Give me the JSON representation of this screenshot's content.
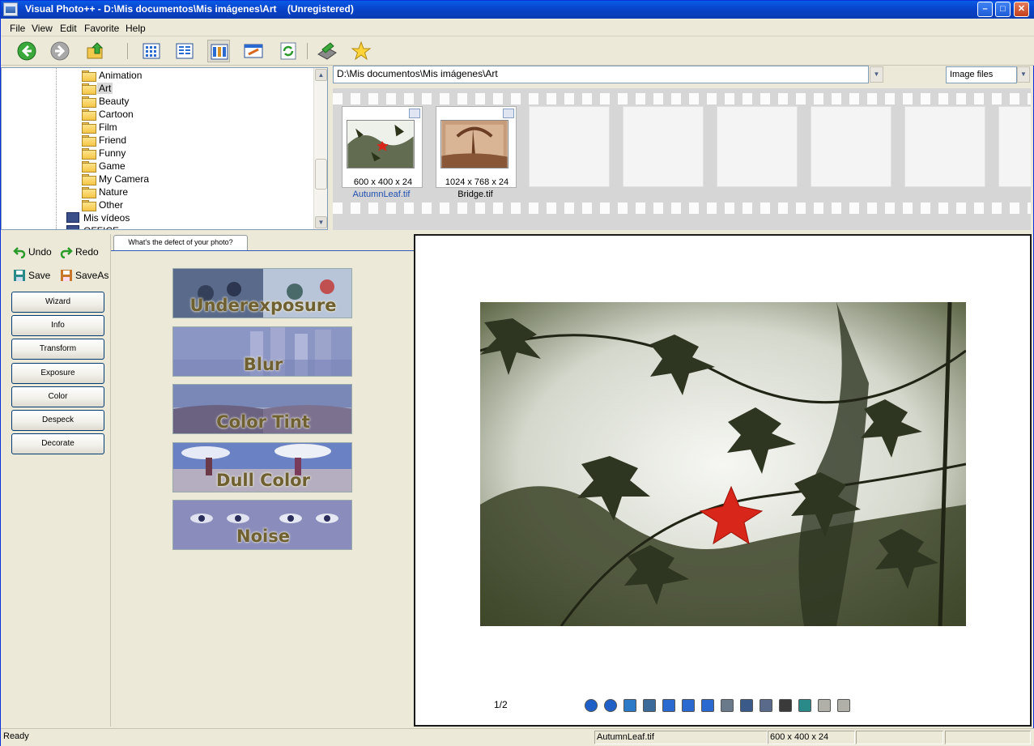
{
  "window": {
    "title": "Visual Photo++ - D:\\Mis documentos\\Mis imágenes\\Art    (Unregistered)",
    "controls": {
      "minimize": "–",
      "maximize": "□",
      "close": "✕"
    }
  },
  "menu": [
    "File",
    "View",
    "Edit",
    "Favorite",
    "Help"
  ],
  "toolbar": {
    "icons": [
      "back-arrow-icon",
      "forward-arrow-icon",
      "up-folder-icon",
      "thumbnail-view-icon",
      "list-view-icon",
      "filmstrip-view-icon",
      "detail-view-icon",
      "refresh-icon",
      "scanner-icon",
      "favorite-star-icon"
    ]
  },
  "tree": {
    "items": [
      {
        "label": "Animation",
        "selected": false
      },
      {
        "label": "Art",
        "selected": true
      },
      {
        "label": "Beauty",
        "selected": false
      },
      {
        "label": "Cartoon",
        "selected": false
      },
      {
        "label": "Film",
        "selected": false
      },
      {
        "label": "Friend",
        "selected": false
      },
      {
        "label": "Funny",
        "selected": false
      },
      {
        "label": "Game",
        "selected": false
      },
      {
        "label": "My Camera",
        "selected": false
      },
      {
        "label": "Nature",
        "selected": false
      },
      {
        "label": "Other",
        "selected": false
      }
    ],
    "extra": [
      {
        "label": "Mis vídeos"
      },
      {
        "label": "OFFICE"
      }
    ]
  },
  "path": {
    "value": "D:\\Mis documentos\\Mis imágenes\\Art"
  },
  "filter": {
    "value": "Image files"
  },
  "thumbnails": [
    {
      "name": "AutumnLeaf.tif",
      "dims": "600 x 400 x 24",
      "selected": true
    },
    {
      "name": "Bridge.tif",
      "dims": "1024 x 768 x 24",
      "selected": false
    }
  ],
  "left": {
    "undo": "Undo",
    "redo": "Redo",
    "save": "Save",
    "saveas": "SaveAs",
    "buttons": [
      "Wizard",
      "Info",
      "Transform",
      "Exposure",
      "Color",
      "Despeck",
      "Decorate"
    ]
  },
  "defects": {
    "tab": "What's the defect of your photo?",
    "items": [
      "Underexposure",
      "Blur",
      "Color Tint",
      "Dull Color",
      "Noise"
    ]
  },
  "viewer": {
    "page": "1/2",
    "tools": [
      "first-page-icon",
      "next-page-icon",
      "rotate-icon",
      "fit-screen-icon",
      "zoom-in-icon",
      "zoom-actual-icon",
      "zoom-out-icon",
      "print-icon",
      "edit-icon",
      "copy-icon",
      "paste-icon",
      "save-icon",
      "disabled-left-icon",
      "disabled-right-icon"
    ]
  },
  "status": {
    "text": "Ready",
    "file": "AutumnLeaf.tif",
    "dims": "600 x 400 x 24"
  },
  "colors": {
    "titlebar": "#0842c8",
    "accent_leaf": "#d8261a"
  }
}
